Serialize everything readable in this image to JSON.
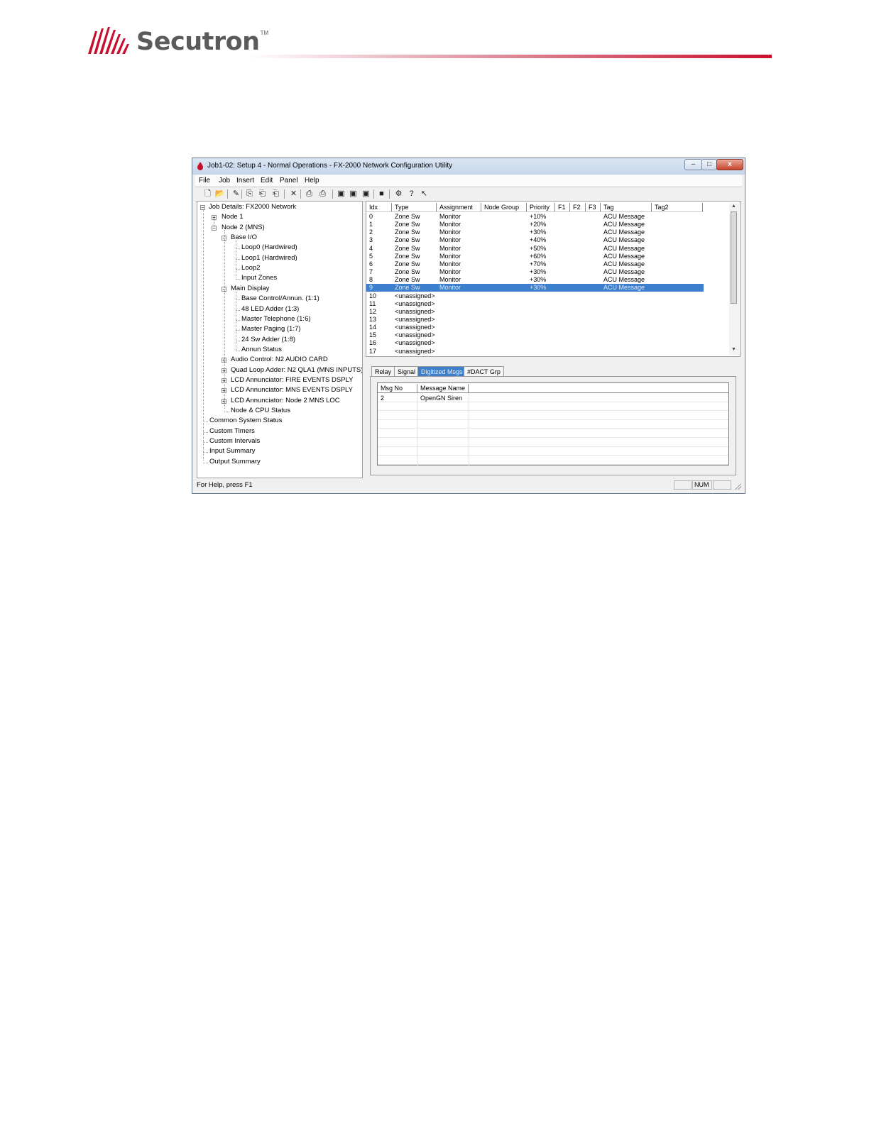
{
  "header": {
    "brand": "Secutron",
    "trademark": "TM",
    "accent_color": "#c8102e"
  },
  "window": {
    "title": "Job1-02: Setup 4 - Normal Operations - FX-2000 Network Configuration Utility",
    "minimize_label": "–",
    "maximize_label": "□",
    "close_label": "x"
  },
  "menu": [
    "File",
    "Job",
    "Insert",
    "Edit",
    "Panel",
    "Help"
  ],
  "toolbar": [
    {
      "icon": "new-file-icon",
      "glyph": "🗋"
    },
    {
      "icon": "open-folder-icon",
      "glyph": "📂"
    },
    {
      "icon": "edit-pencil-icon",
      "glyph": "✎"
    },
    {
      "icon": "copy-icon",
      "glyph": "⎘"
    },
    {
      "icon": "paste-icon",
      "glyph": "⎗"
    },
    {
      "icon": "paste-special-icon",
      "glyph": "⎗"
    },
    {
      "icon": "delete-icon",
      "glyph": "✕"
    },
    {
      "icon": "print-icon",
      "glyph": "⎙"
    },
    {
      "icon": "print-preview-icon",
      "glyph": "⎙"
    },
    {
      "icon": "network-connect-icon",
      "glyph": "▣"
    },
    {
      "icon": "network-download-icon",
      "glyph": "▣"
    },
    {
      "icon": "network-upload-icon",
      "glyph": "▣"
    },
    {
      "icon": "panel-icon",
      "glyph": "■"
    },
    {
      "icon": "settings-icon",
      "glyph": "⚙"
    },
    {
      "icon": "help-icon",
      "glyph": "?"
    },
    {
      "icon": "context-help-icon",
      "glyph": "↖"
    }
  ],
  "tree": [
    {
      "label": "Job Details: FX2000 Network",
      "level": 0,
      "expander": "-"
    },
    {
      "label": "Node 1",
      "level": 1,
      "expander": "+"
    },
    {
      "label": "Node 2 (MNS)",
      "level": 1,
      "expander": "-"
    },
    {
      "label": "Base I/O",
      "level": 2,
      "expander": "-"
    },
    {
      "label": "Loop0  (Hardwired)",
      "level": 3,
      "expander": ""
    },
    {
      "label": "Loop1  (Hardwired)",
      "level": 3,
      "expander": ""
    },
    {
      "label": "Loop2",
      "level": 3,
      "expander": ""
    },
    {
      "label": "Input Zones",
      "level": 3,
      "expander": ""
    },
    {
      "label": "Main Display",
      "level": 2,
      "expander": "-"
    },
    {
      "label": "Base Control/Annun. (1:1)",
      "level": 3,
      "expander": ""
    },
    {
      "label": "48 LED Adder (1:3)",
      "level": 3,
      "expander": ""
    },
    {
      "label": "Master Telephone (1:6)",
      "level": 3,
      "expander": ""
    },
    {
      "label": "Master Paging (1:7)",
      "level": 3,
      "expander": ""
    },
    {
      "label": "24 Sw Adder (1:8)",
      "level": 3,
      "expander": ""
    },
    {
      "label": "Annun Status",
      "level": 3,
      "expander": ""
    },
    {
      "label": "Audio Control: N2 AUDIO CARD",
      "level": 2,
      "expander": "+"
    },
    {
      "label": "Quad Loop Adder: N2 QLA1 (MNS INPUTS)",
      "level": 2,
      "expander": "+"
    },
    {
      "label": "LCD Annunciator: FIRE EVENTS DSPLY",
      "level": 2,
      "expander": "+"
    },
    {
      "label": "LCD Annunciator: MNS EVENTS DSPLY",
      "level": 2,
      "expander": "+"
    },
    {
      "label": "LCD Annunciator: Node 2 MNS LOC",
      "level": 2,
      "expander": "+"
    },
    {
      "label": "Node & CPU Status",
      "level": 2,
      "expander": ""
    },
    {
      "label": "Common System Status",
      "level": 0.5,
      "expander": ""
    },
    {
      "label": "Custom Timers",
      "level": 0.5,
      "expander": ""
    },
    {
      "label": "Custom Intervals",
      "level": 0.5,
      "expander": ""
    },
    {
      "label": "Input Summary",
      "level": 0.5,
      "expander": ""
    },
    {
      "label": "Output Summary",
      "level": 0.5,
      "expander": ""
    }
  ],
  "grid": {
    "columns": [
      "Idx",
      "Type",
      "Assignment",
      "Node Group",
      "Priority",
      "F1",
      "F2",
      "F3",
      "Tag",
      "Tag2"
    ],
    "selected_index": 9,
    "rows": [
      [
        "0",
        "Zone Sw",
        "Monitor",
        "",
        "+10%",
        "",
        "",
        "",
        "ACU Message",
        ""
      ],
      [
        "1",
        "Zone Sw",
        "Monitor",
        "",
        "+20%",
        "",
        "",
        "",
        "ACU Message",
        ""
      ],
      [
        "2",
        "Zone Sw",
        "Monitor",
        "",
        "+30%",
        "",
        "",
        "",
        "ACU Message",
        ""
      ],
      [
        "3",
        "Zone Sw",
        "Monitor",
        "",
        "+40%",
        "",
        "",
        "",
        "ACU Message",
        ""
      ],
      [
        "4",
        "Zone Sw",
        "Monitor",
        "",
        "+50%",
        "",
        "",
        "",
        "ACU Message",
        ""
      ],
      [
        "5",
        "Zone Sw",
        "Monitor",
        "",
        "+60%",
        "",
        "",
        "",
        "ACU Message",
        ""
      ],
      [
        "6",
        "Zone Sw",
        "Monitor",
        "",
        "+70%",
        "",
        "",
        "",
        "ACU Message",
        ""
      ],
      [
        "7",
        "Zone Sw",
        "Monitor",
        "",
        "+30%",
        "",
        "",
        "",
        "ACU Message",
        ""
      ],
      [
        "8",
        "Zone Sw",
        "Monitor",
        "",
        "+30%",
        "",
        "",
        "",
        "ACU Message",
        ""
      ],
      [
        "9",
        "Zone Sw",
        "Monitor",
        "",
        "+30%",
        "",
        "",
        "",
        "ACU Message",
        ""
      ],
      [
        "10",
        "<unassigned>",
        "",
        "",
        "",
        "",
        "",
        "",
        "",
        ""
      ],
      [
        "11",
        "<unassigned>",
        "",
        "",
        "",
        "",
        "",
        "",
        "",
        ""
      ],
      [
        "12",
        "<unassigned>",
        "",
        "",
        "",
        "",
        "",
        "",
        "",
        ""
      ],
      [
        "13",
        "<unassigned>",
        "",
        "",
        "",
        "",
        "",
        "",
        "",
        ""
      ],
      [
        "14",
        "<unassigned>",
        "",
        "",
        "",
        "",
        "",
        "",
        "",
        ""
      ],
      [
        "15",
        "<unassigned>",
        "",
        "",
        "",
        "",
        "",
        "",
        "",
        ""
      ],
      [
        "16",
        "<unassigned>",
        "",
        "",
        "",
        "",
        "",
        "",
        "",
        ""
      ],
      [
        "17",
        "<unassigned>",
        "",
        "",
        "",
        "",
        "",
        "",
        "",
        ""
      ]
    ]
  },
  "tabs": [
    {
      "label": "Relay",
      "active": false
    },
    {
      "label": "Signal",
      "active": false
    },
    {
      "label": "Digitized Msgs",
      "active": true
    },
    {
      "label": "#DACT Grp",
      "active": false
    }
  ],
  "messages": {
    "columns": [
      "Msg No",
      "Message Name"
    ],
    "rows": [
      [
        "2",
        "OpenGN Siren"
      ]
    ]
  },
  "status": {
    "help_text": "For Help, press F1",
    "num": "NUM"
  }
}
